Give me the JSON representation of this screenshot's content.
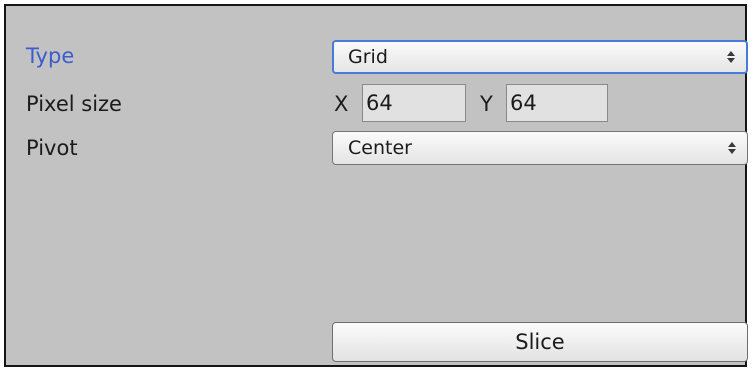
{
  "fields": {
    "type": {
      "label": "Type",
      "value": "Grid"
    },
    "pixel_size": {
      "label": "Pixel size",
      "x_label": "X",
      "x_value": "64",
      "y_label": "Y",
      "y_value": "64"
    },
    "pivot": {
      "label": "Pivot",
      "value": "Center"
    }
  },
  "slice_button": {
    "label": "Slice"
  },
  "colors": {
    "background": "#c2c2c2",
    "focus_label": "#3b5ccf",
    "focus_border": "#4a7ad8"
  }
}
